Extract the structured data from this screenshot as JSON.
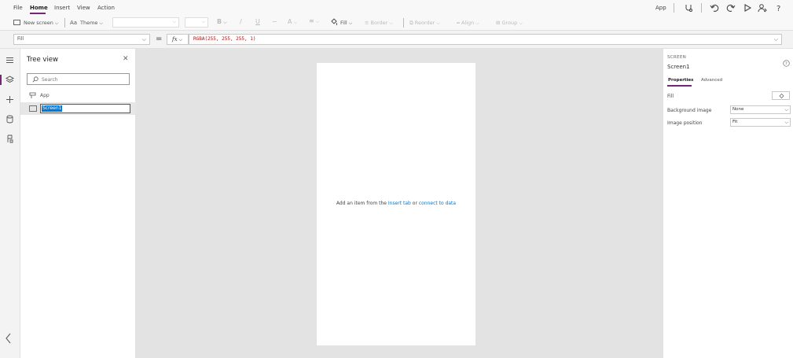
{
  "menu": {
    "items": [
      {
        "label": "File"
      },
      {
        "label": "Home",
        "active": true
      },
      {
        "label": "Insert"
      },
      {
        "label": "View"
      },
      {
        "label": "Action"
      }
    ],
    "right_label": "App"
  },
  "toolbar": {
    "new_screen": "New screen",
    "theme": "Theme",
    "fill": "Fill",
    "border": "Border",
    "reorder": "Reorder",
    "align": "Align",
    "group": "Group",
    "bold": "B",
    "italic": "/",
    "underline": "U",
    "strikethrough": "−",
    "font_color": "A"
  },
  "formula_bar": {
    "property": "Fill",
    "equals": "=",
    "fx_label": "fx",
    "formula": "RGBA(255, 255, 255, 1)"
  },
  "tree_view": {
    "title": "Tree view",
    "search_placeholder": "Search",
    "items": [
      {
        "label": "App"
      },
      {
        "label": "Screen1",
        "selected": true
      }
    ]
  },
  "canvas": {
    "message_prefix": "Add an item from the ",
    "insert_link": "Insert tab",
    "message_middle": " or ",
    "connect_link": "connect to data"
  },
  "properties": {
    "control_type": "SCREEN",
    "control_name": "Screen1",
    "tabs": [
      {
        "label": "Properties",
        "active": true
      },
      {
        "label": "Advanced"
      }
    ],
    "fill_label": "Fill",
    "background_image_label": "Background image",
    "background_image_value": "None",
    "image_position_label": "Image position",
    "image_position_value": "Fit"
  },
  "colors": {
    "accent": "#742774",
    "link": "#0078d4",
    "canvas_bg": "#e3e3e3",
    "selection": "#0078d4"
  }
}
